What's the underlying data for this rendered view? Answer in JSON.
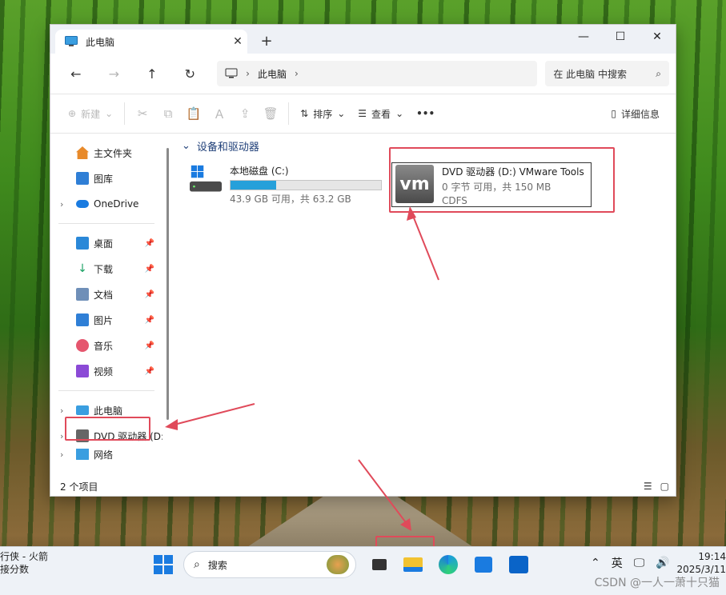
{
  "window": {
    "tab_title": "此电脑",
    "new_tab": "+",
    "controls": {
      "minimize": "—",
      "maximize": "☐",
      "close": "✕"
    }
  },
  "address": {
    "crumb": "此电脑",
    "search_placeholder": "在 此电脑 中搜索"
  },
  "toolbar": {
    "new_label": "新建",
    "sort_label": "排序",
    "view_label": "查看",
    "more_label": "•••",
    "details_label": "详细信息"
  },
  "sidebar": {
    "home": "主文件夹",
    "gallery": "图库",
    "onedrive": "OneDrive",
    "pinned": [
      {
        "label": "桌面",
        "color": "#2a88d8"
      },
      {
        "label": "下载",
        "color": "#1aa163"
      },
      {
        "label": "文档",
        "color": "#6f8fb8"
      },
      {
        "label": "图片",
        "color": "#2f7fd6"
      },
      {
        "label": "音乐",
        "color": "#e5566e"
      },
      {
        "label": "视频",
        "color": "#8b4ad6"
      }
    ],
    "this_pc": "此电脑",
    "dvd": "DVD 驱动器 (D:",
    "net": "网络"
  },
  "content": {
    "group_title": "设备和驱动器",
    "drive_c": {
      "name": "本地磁盘 (C:)",
      "space": "43.9 GB 可用，共 63.2 GB",
      "used_fraction": 0.305
    },
    "drive_d": {
      "logo": "vm",
      "name": "DVD 驱动器 (D:) VMware Tools",
      "space": "0 字节 可用，共 150 MB",
      "fs": "CDFS"
    }
  },
  "status": {
    "count": "2 个项目"
  },
  "taskbar": {
    "left_line1": "行侠 - 火箭",
    "left_line2": "接分数",
    "search_label": "搜索",
    "ime": "英",
    "time": "19:14",
    "date": "2025/3/11"
  },
  "watermark": "CSDN @一人一萧十只猫",
  "colors": {
    "accent": "#26a0da",
    "highlight": "#e04a5a"
  }
}
